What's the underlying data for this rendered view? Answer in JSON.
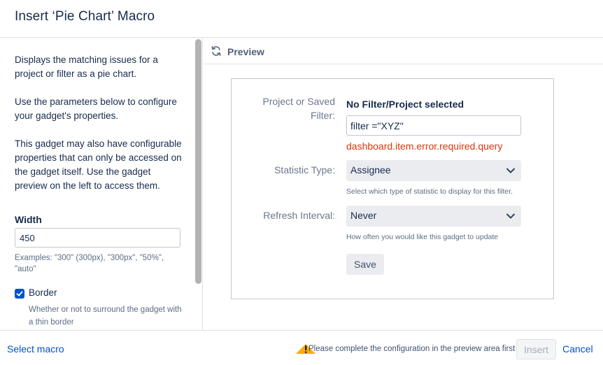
{
  "dialog": {
    "title": "Insert ‘Pie Chart’ Macro"
  },
  "left": {
    "para1": "Displays the matching issues for a project or filter as a pie chart.",
    "para2": "Use the parameters below to configure your gadget's properties.",
    "para3": "This gadget may also have configurable properties that can only be accessed on the gadget itself. Use the gadget preview on the left to access them.",
    "width": {
      "label": "Width",
      "value": "450",
      "help": "Examples: \"300\" (300px), \"300px\", \"50%\", \"auto\""
    },
    "border": {
      "label": "Border",
      "checked": true,
      "help": "Whether or not to surround the gadget with a thin border"
    }
  },
  "preview": {
    "title": "Preview",
    "icon": "refresh-icon",
    "filter": {
      "label": "Project or Saved Filter:",
      "status": "No Filter/Project selected",
      "value": "filter =\"XYZ\"",
      "error": "dashboard.item.error.required.query"
    },
    "statistic": {
      "label": "Statistic Type:",
      "selected": "Assignee",
      "help": "Select which type of statistic to display for this filter."
    },
    "refresh": {
      "label": "Refresh Interval:",
      "selected": "Never",
      "help": "How often you would like this gadget to update"
    },
    "save_label": "Save"
  },
  "footer": {
    "select_macro": "Select macro",
    "warning": "Please complete the configuration in the preview area first",
    "insert_label": "Insert",
    "cancel_label": "Cancel"
  },
  "colors": {
    "link": "#0052cc",
    "error": "#de350b",
    "warning": "#ffab00",
    "checkbox": "#0052cc"
  }
}
